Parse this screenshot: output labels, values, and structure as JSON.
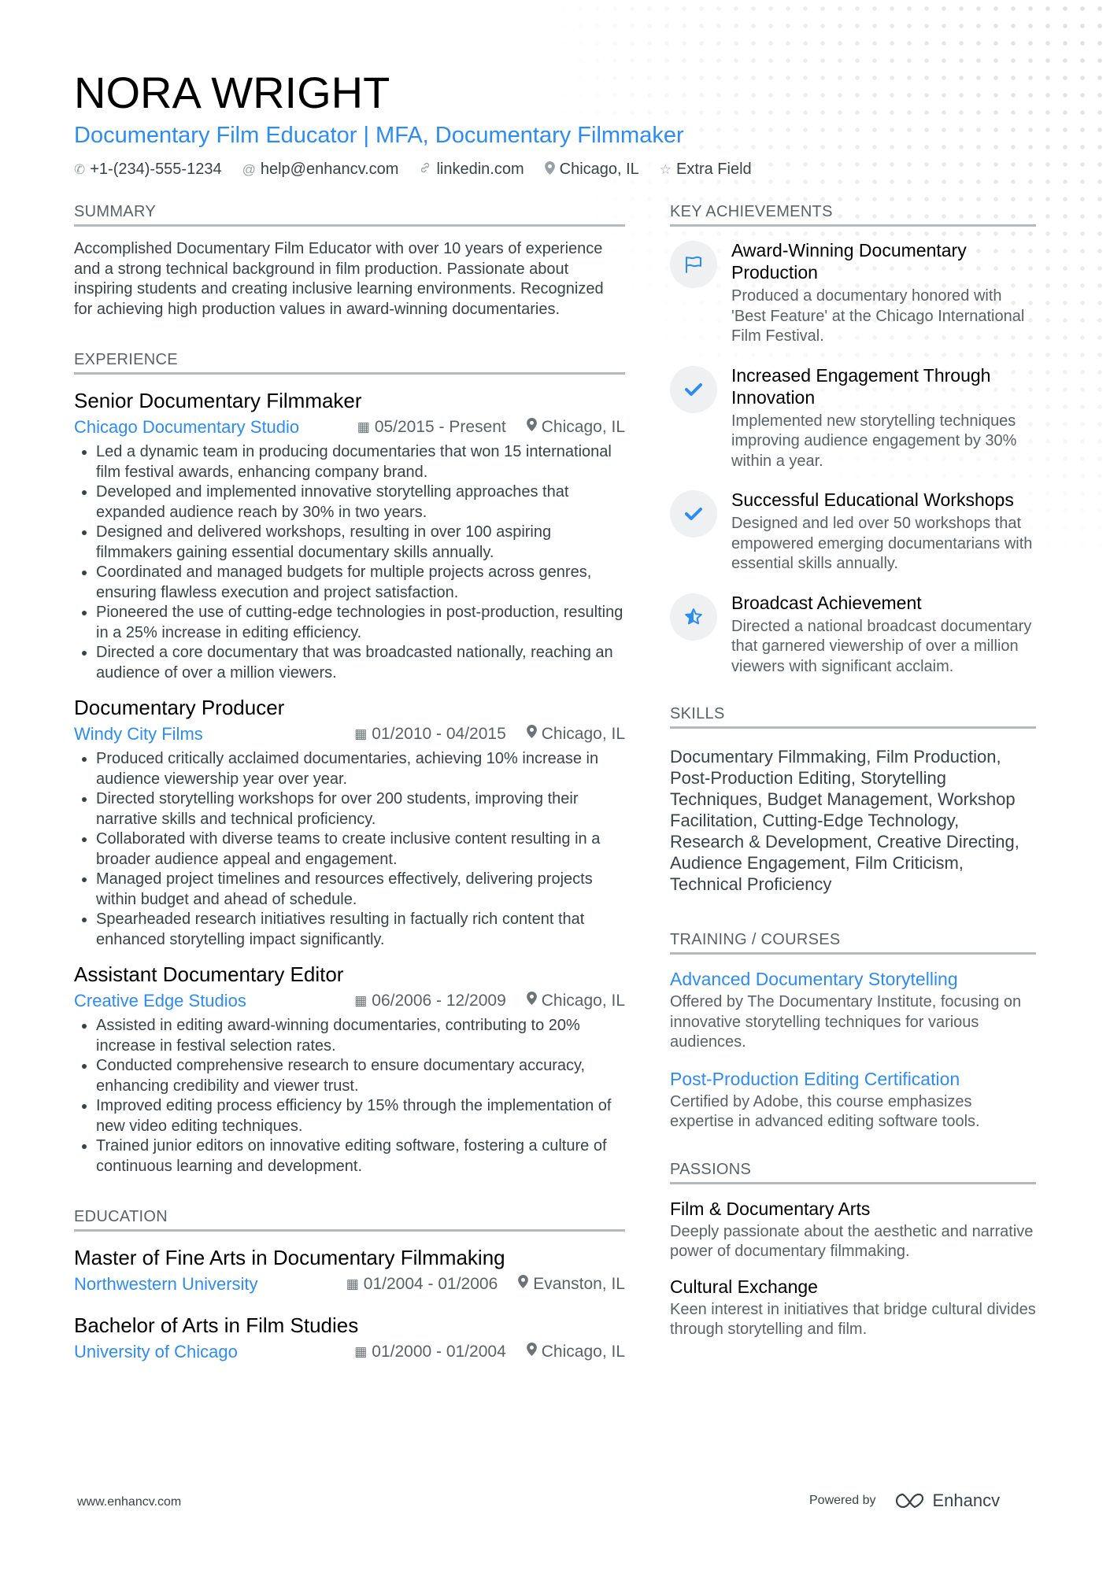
{
  "header": {
    "name": "NORA WRIGHT",
    "title": "Documentary Film Educator | MFA, Documentary Filmmaker",
    "contacts": [
      {
        "icon": "phone-icon",
        "glyph": "✆",
        "text": "+1-(234)-555-1234"
      },
      {
        "icon": "at-icon",
        "glyph": "@",
        "text": "help@enhancv.com"
      },
      {
        "icon": "link-icon",
        "glyph": "🔗",
        "text": "linkedin.com"
      },
      {
        "icon": "location-icon",
        "glyph": "⚲",
        "text": "Chicago, IL"
      },
      {
        "icon": "star-icon",
        "glyph": "☆",
        "text": "Extra Field"
      }
    ]
  },
  "summary": {
    "heading": "SUMMARY",
    "text": "Accomplished Documentary Film Educator with over 10 years of experience and a strong technical background in film production. Passionate about inspiring students and creating inclusive learning environments. Recognized for achieving high production values in award-winning documentaries."
  },
  "experience": {
    "heading": "EXPERIENCE",
    "jobs": [
      {
        "title": "Senior Documentary Filmmaker",
        "company": "Chicago Documentary Studio",
        "dates": "05/2015 - Present",
        "location": "Chicago, IL",
        "bullets": [
          "Led a dynamic team in producing documentaries that won 15 international film festival awards, enhancing company brand.",
          "Developed and implemented innovative storytelling approaches that expanded audience reach by 30% in two years.",
          "Designed and delivered workshops, resulting in over 100 aspiring filmmakers gaining essential documentary skills annually.",
          "Coordinated and managed budgets for multiple projects across genres, ensuring flawless execution and project satisfaction.",
          "Pioneered the use of cutting-edge technologies in post-production, resulting in a 25% increase in editing efficiency.",
          "Directed a core documentary that was broadcasted nationally, reaching an audience of over a million viewers."
        ]
      },
      {
        "title": "Documentary Producer",
        "company": "Windy City Films",
        "dates": "01/2010 - 04/2015",
        "location": "Chicago, IL",
        "bullets": [
          "Produced critically acclaimed documentaries, achieving 10% increase in audience viewership year over year.",
          "Directed storytelling workshops for over 200 students, improving their narrative skills and technical proficiency.",
          "Collaborated with diverse teams to create inclusive content resulting in a broader audience appeal and engagement.",
          "Managed project timelines and resources effectively, delivering projects within budget and ahead of schedule.",
          "Spearheaded research initiatives resulting in factually rich content that enhanced storytelling impact significantly."
        ]
      },
      {
        "title": "Assistant Documentary Editor",
        "company": "Creative Edge Studios",
        "dates": "06/2006 - 12/2009",
        "location": "Chicago, IL",
        "bullets": [
          "Assisted in editing award-winning documentaries, contributing to 20% increase in festival selection rates.",
          "Conducted comprehensive research to ensure documentary accuracy, enhancing credibility and viewer trust.",
          "Improved editing process efficiency by 15% through the implementation of new video editing techniques.",
          "Trained junior editors on innovative editing software, fostering a culture of continuous learning and development."
        ]
      }
    ]
  },
  "education": {
    "heading": "EDUCATION",
    "items": [
      {
        "degree": "Master of Fine Arts in Documentary Filmmaking",
        "school": "Northwestern University",
        "dates": "01/2004 - 01/2006",
        "location": "Evanston, IL"
      },
      {
        "degree": "Bachelor of Arts in Film Studies",
        "school": "University of Chicago",
        "dates": "01/2000 - 01/2004",
        "location": "Chicago, IL"
      }
    ]
  },
  "achievements": {
    "heading": "KEY ACHIEVEMENTS",
    "items": [
      {
        "icon": "flag-icon",
        "glyph": "⚐",
        "title": "Award-Winning Documentary Production",
        "desc": "Produced a documentary honored with 'Best Feature' at the Chicago International Film Festival."
      },
      {
        "icon": "check-icon",
        "glyph": "✔",
        "title": "Increased Engagement Through Innovation",
        "desc": "Implemented new storytelling techniques improving audience engagement by 30% within a year."
      },
      {
        "icon": "check-icon",
        "glyph": "✔",
        "title": "Successful Educational Workshops",
        "desc": "Designed and led over 50 workshops that empowered emerging documentarians with essential skills annually."
      },
      {
        "icon": "star-half-icon",
        "glyph": "★",
        "title": "Broadcast Achievement",
        "desc": "Directed a national broadcast documentary that garnered viewership of over a million viewers with significant acclaim."
      }
    ]
  },
  "skills": {
    "heading": "SKILLS",
    "text": "Documentary Filmmaking, Film Production, Post-Production Editing, Storytelling Techniques, Budget Management, Workshop Facilitation, Cutting-Edge Technology, Research & Development, Creative Directing, Audience Engagement, Film Criticism, Technical Proficiency"
  },
  "training": {
    "heading": "TRAINING / COURSES",
    "items": [
      {
        "title": "Advanced Documentary Storytelling",
        "desc": "Offered by The Documentary Institute, focusing on innovative storytelling techniques for various audiences."
      },
      {
        "title": "Post-Production Editing Certification",
        "desc": "Certified by Adobe, this course emphasizes expertise in advanced editing software tools."
      }
    ]
  },
  "passions": {
    "heading": "PASSIONS",
    "items": [
      {
        "title": "Film & Documentary Arts",
        "desc": "Deeply passionate about the aesthetic and narrative power of documentary filmmaking."
      },
      {
        "title": "Cultural Exchange",
        "desc": "Keen interest in initiatives that bridge cultural divides through storytelling and film."
      }
    ]
  },
  "footer": {
    "website": "www.enhancv.com",
    "powered_by": "Powered by",
    "brand": "Enhancv"
  },
  "icons": {
    "calendar": "▦",
    "pin": "⚲"
  },
  "colors": {
    "accent": "#2d8cf0",
    "text": "#384347",
    "muted": "#5b6266"
  }
}
